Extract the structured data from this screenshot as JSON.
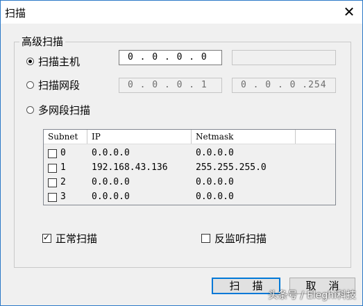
{
  "window": {
    "title": "扫描",
    "close_glyph": "✕"
  },
  "group": {
    "legend": "高级扫描"
  },
  "modes": [
    {
      "label": "扫描主机",
      "checked": true
    },
    {
      "label": "扫描网段",
      "checked": false
    },
    {
      "label": "多网段扫描",
      "checked": false
    }
  ],
  "host_ip": {
    "value": "0 . 0 . 0 . 0",
    "extra_value": ""
  },
  "segment": {
    "start": "0 . 0 . 0 . 1",
    "end": "0 . 0 . 0 .254"
  },
  "table": {
    "columns": [
      "Subnet",
      "IP",
      "Netmask"
    ],
    "rows": [
      {
        "subnet": "0",
        "ip": "0.0.0.0",
        "netmask": "0.0.0.0",
        "checked": false
      },
      {
        "subnet": "1",
        "ip": "192.168.43.136",
        "netmask": "255.255.255.0",
        "checked": false
      },
      {
        "subnet": "2",
        "ip": "0.0.0.0",
        "netmask": "0.0.0.0",
        "checked": false
      },
      {
        "subnet": "3",
        "ip": "0.0.0.0",
        "netmask": "0.0.0.0",
        "checked": false
      }
    ]
  },
  "options": {
    "normal_scan": {
      "label": "正常扫描",
      "checked": true
    },
    "anti_listen_scan": {
      "label": "反监听扫描",
      "checked": false
    }
  },
  "buttons": {
    "scan": "扫描",
    "cancel": "取消"
  },
  "watermark": "头条号 / Eleghi科技",
  "colors": {
    "accent": "#0078d7",
    "titlebar_border": "#2b79c7"
  }
}
